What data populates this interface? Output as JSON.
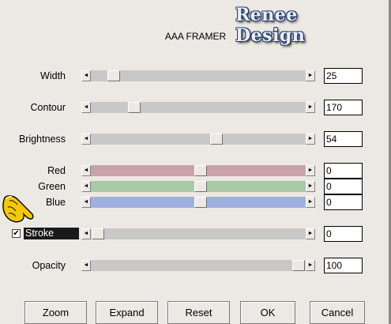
{
  "watermark": "Renee Design",
  "title": "AAA FRAMER",
  "controls": {
    "width": {
      "label": "Width",
      "value": "25",
      "level": 0.08
    },
    "contour": {
      "label": "Contour",
      "value": "170",
      "level": 0.18
    },
    "brightness": {
      "label": "Brightness",
      "value": "54",
      "level": 0.59
    },
    "red": {
      "label": "Red",
      "value": "0",
      "level": 0.51,
      "color": "#c9a3a9"
    },
    "green": {
      "label": "Green",
      "value": "0",
      "level": 0.51,
      "color": "#a8c8a8"
    },
    "blue": {
      "label": "Blue",
      "value": "0",
      "level": 0.51,
      "color": "#9fb0e0"
    },
    "stroke": {
      "label": "Stroke",
      "value": "0",
      "level": 0.0,
      "checked": true
    },
    "opacity": {
      "label": "Opacity",
      "value": "100",
      "level": 1.0
    }
  },
  "buttons": {
    "zoom": "Zoom",
    "expand": "Expand",
    "reset": "Reset",
    "ok": "OK",
    "cancel": "Cancel"
  },
  "glyphs": {
    "arrow_left": "◄",
    "arrow_right": "►",
    "check": "✔"
  },
  "colors": {
    "background": "#ece9e4",
    "track": "#c8c8c8",
    "stroke_highlight": "#1a1a1a"
  }
}
